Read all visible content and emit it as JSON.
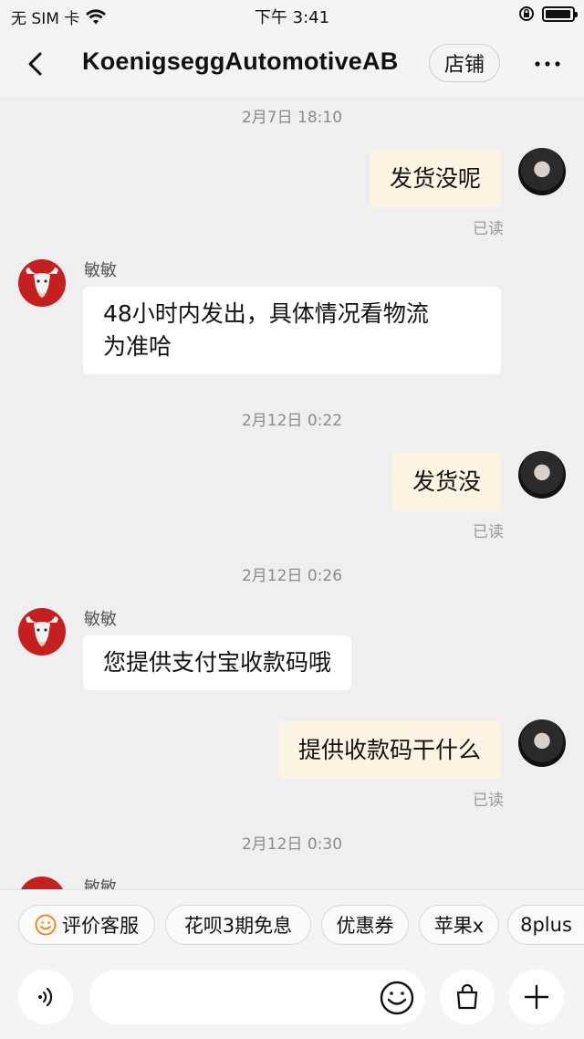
{
  "status_bar": {
    "carrier": "无 SIM 卡",
    "time": "下午 3:41",
    "battery_level": 0.95
  },
  "header": {
    "title": "KoenigseggAutomotiveAB",
    "shop_label": "店铺"
  },
  "messages": {
    "ts1": "2月7日 18:10",
    "m1_text": "发货没呢",
    "m1_status": "已读",
    "m2_sender": "敏敏",
    "m2_text_line1": "48小时内发出，具体情况看物流",
    "m2_text_line2": "为准哈",
    "ts2": "2月12日 0:22",
    "m3_text": "发货没",
    "m3_status": "已读",
    "ts3": "2月12日 0:26",
    "m4_sender": "敏敏",
    "m4_text": "您提供支付宝收款码哦",
    "m5_text": "提供收款码干什么",
    "m5_status": "已读",
    "ts4": "2月12日 0:30",
    "m6_sender": "敏敏"
  },
  "quick_replies": [
    "评价客服",
    "花呗3期免息",
    "优惠券",
    "苹果x",
    "8plus"
  ],
  "input": {
    "placeholder": ""
  },
  "icons": {
    "back": "chevron-left-icon",
    "more": "more-dots-icon",
    "voice": "voice-icon",
    "emoji": "smile-icon",
    "bag": "shopping-bag-icon",
    "add": "plus-icon"
  },
  "colors": {
    "self_bubble": "#fdf3e3",
    "other_bubble": "#ffffff",
    "background": "#efefef",
    "bull_avatar": "#c42020"
  }
}
